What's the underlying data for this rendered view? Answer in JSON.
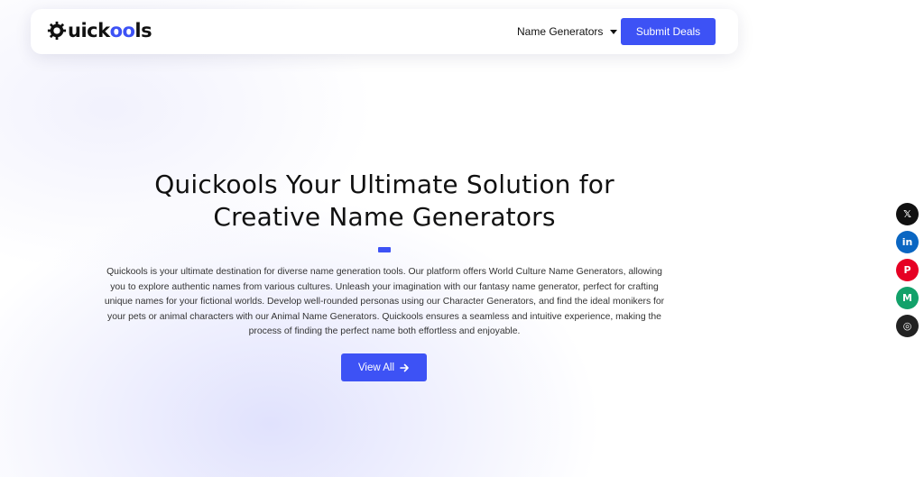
{
  "brand": {
    "logo_prefix": "uick",
    "logo_oo": "oo",
    "logo_suffix": "ls",
    "accent": "#3d52f5"
  },
  "nav": {
    "menu_label": "Name Generators",
    "submit_label": "Submit Deals"
  },
  "hero": {
    "title": "Quickools Your Ultimate Solution for Creative Name Generators",
    "description": "Quickools is your ultimate destination for diverse name generation tools. Our platform offers World Culture Name Generators, allowing you to explore authentic names from various cultures. Unleash your imagination with our fantasy name generator, perfect for crafting unique names for your fictional worlds. Develop well-rounded personas using our Character Generators, and find the ideal monikers for your pets or animal characters with our Animal Name Generators. Quickools ensures a seamless and intuitive experience, making the process of finding the perfect name both effortless and enjoyable.",
    "cta_label": "View All"
  },
  "social": [
    {
      "icon": "x-icon",
      "glyph": "𝕏",
      "color": "#111111"
    },
    {
      "icon": "linkedin-icon",
      "glyph": "in",
      "color": "#0a66c2"
    },
    {
      "icon": "pinterest-icon",
      "glyph": "P",
      "color": "#e60023"
    },
    {
      "icon": "medium-icon",
      "glyph": "M",
      "color": "#12a16a"
    },
    {
      "icon": "instagram-icon",
      "glyph": "◎",
      "color": "#222222"
    }
  ]
}
